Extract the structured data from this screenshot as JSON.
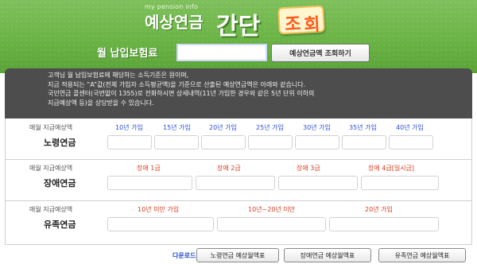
{
  "header": {
    "subtitle": "my pension info",
    "title_part1": "예상연금",
    "title_part2": "간단",
    "badge_char1": "조",
    "badge_char2": "회"
  },
  "input_row": {
    "label": "월 납입보험료",
    "premium_value": "",
    "button_label": "예상연금액 조회하기"
  },
  "notice": {
    "lines": [
      "고객님 월 납입보험료에 해당하는 소득기준은      원이며,",
      "지금 적용되는 “A”값(전체 가입자 소득평균액)을 기준으로 산출된 예상연금액은 아래와 같습니다.",
      "국민연금 콜센터(국번없이 1355)로 전화하시면 상세내역(11년 가입한 경우와 같은 5년 단위 이하의",
      "지급예상액 등)을 상담받을 수 있습니다."
    ]
  },
  "sections": {
    "old_age": {
      "small_label": "매월 지급예상액",
      "title": "노령연금",
      "columns": [
        "10년 가입",
        "15년 가입",
        "20년 가입",
        "25년 가입",
        "30년 가입",
        "35년 가입",
        "40년 가입"
      ],
      "values": [
        "",
        "",
        "",
        "",
        "",
        "",
        ""
      ]
    },
    "disability": {
      "small_label": "매월 지급예상액",
      "title": "장애연금",
      "columns": [
        "장애 1급",
        "장애 2급",
        "장애 3급",
        "장애 4급[일시금]"
      ],
      "values": [
        "",
        "",
        "",
        ""
      ]
    },
    "survivor": {
      "small_label": "매월 지급예상액",
      "title": "유족연금",
      "columns": [
        "10년 미만 가입",
        "10년~20년 미만",
        "20년 가입"
      ],
      "values": [
        "",
        "",
        ""
      ]
    }
  },
  "footer": {
    "download_label": "다운로드",
    "buttons": [
      "노령연금 예상월액표",
      "장애연금 예상월액표",
      "유족연금 예상월액표"
    ]
  },
  "colors": {
    "header_green": "#6ab345",
    "notice_bg": "#4d4d4d",
    "label_blue": "#2a4fd6",
    "label_red": "#d93a1e",
    "badge_orange": "#ff5a1a"
  }
}
